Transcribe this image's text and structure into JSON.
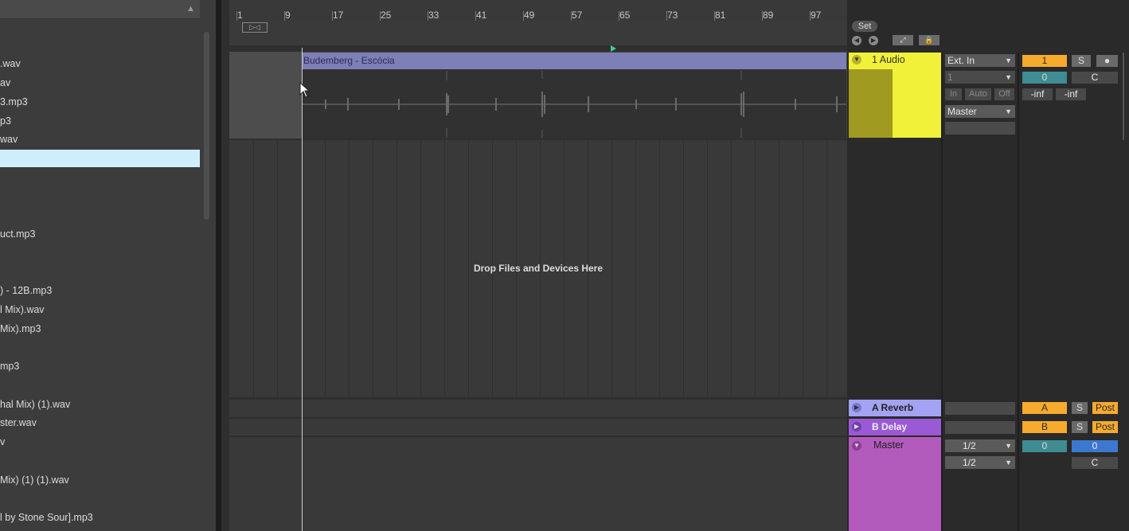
{
  "browser": {
    "files": [
      ".wav",
      "av",
      "3.mp3",
      "p3",
      "wav",
      "",
      "uct.mp3",
      ") - 12B.mp3",
      "l Mix).wav",
      "Mix).mp3",
      "mp3",
      "hal Mix) (1).wav",
      "ster.wav",
      "v",
      "Mix) (1) (1).wav",
      "l by Stone Sour].mp3"
    ]
  },
  "ruler": {
    "ticks": [
      "1",
      "9",
      "17",
      "25",
      "33",
      "41",
      "49",
      "57",
      "65",
      "73",
      "81",
      "89",
      "97"
    ]
  },
  "arrangement": {
    "clip_name": "Budemberg - Escócia",
    "drop_hint": "Drop Files and Devices Here",
    "set_label": "Set"
  },
  "tracks": {
    "audio": {
      "name": "1 Audio",
      "input": "Ext. In",
      "input_channel": "1",
      "monitor": [
        "In",
        "Auto",
        "Off"
      ],
      "output": "Master",
      "number": "1",
      "solo": "S",
      "volume": "0",
      "pan": "C",
      "meter_l": "-inf",
      "meter_r": "-inf"
    },
    "returnA": {
      "name": "A Reverb",
      "letter": "A",
      "solo": "S",
      "post": "Post"
    },
    "returnB": {
      "name": "B Delay",
      "letter": "B",
      "solo": "S",
      "post": "Post"
    },
    "master": {
      "name": "Master",
      "out1": "1/2",
      "out2": "1/2",
      "vol_a": "0",
      "vol_b": "0",
      "pan": "C"
    }
  },
  "colors": {
    "audio_track": "#f1f13a",
    "clip": "#7d7fb6",
    "return_a": "#a3a2f3",
    "return_b": "#9a5ad5",
    "master": "#b35bbc",
    "accent_orange": "#f6aa2e"
  }
}
